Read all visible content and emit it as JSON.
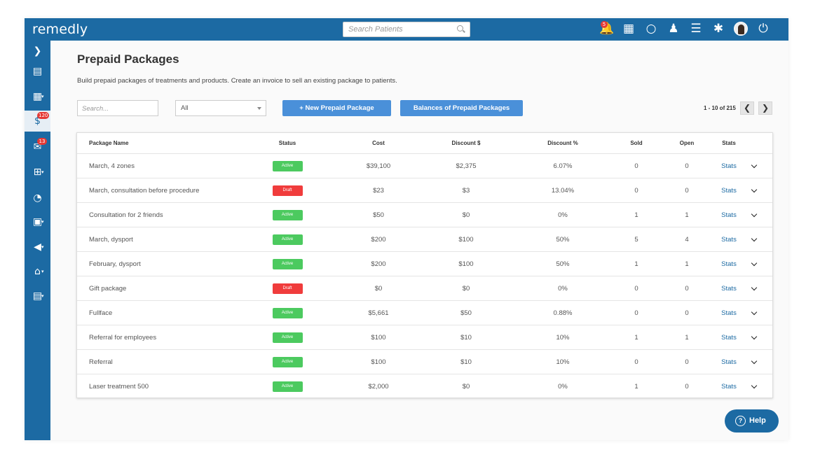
{
  "app": {
    "logo": "remedly"
  },
  "header": {
    "search_placeholder": "Search Patients",
    "icons": [
      {
        "name": "notifications-bell-icon",
        "glyph": "🔔",
        "badge": "5"
      },
      {
        "name": "calendar-icon",
        "glyph": "▦",
        "badge": ""
      },
      {
        "name": "chat-bubble-icon",
        "glyph": "○",
        "badge": ""
      },
      {
        "name": "add-patient-icon",
        "glyph": "♟",
        "badge": ""
      },
      {
        "name": "list-icon",
        "glyph": "☰",
        "badge": ""
      },
      {
        "name": "settings-gear-icon",
        "glyph": "✱",
        "badge": ""
      }
    ]
  },
  "sidebar": {
    "items": [
      {
        "name": "expand-chevron-icon",
        "glyph": "❯",
        "badge": "",
        "caret": false
      },
      {
        "name": "clipboard-icon",
        "glyph": "▤",
        "badge": "",
        "caret": false
      },
      {
        "name": "calendar-menu-icon",
        "glyph": "▦",
        "badge": "",
        "caret": true
      },
      {
        "name": "billing-dollar-icon",
        "glyph": "$",
        "badge": "120",
        "caret": false,
        "active": true
      },
      {
        "name": "messages-icon",
        "glyph": "✉",
        "badge": "13",
        "caret": false
      },
      {
        "name": "medical-kit-icon",
        "glyph": "⊞",
        "badge": "",
        "caret": true
      },
      {
        "name": "reports-pie-icon",
        "glyph": "◔",
        "badge": "",
        "caret": false
      },
      {
        "name": "calculator-icon",
        "glyph": "▣",
        "badge": "",
        "caret": true
      },
      {
        "name": "marketing-megaphone-icon",
        "glyph": "◀",
        "badge": "",
        "caret": true
      },
      {
        "name": "clinic-settings-icon",
        "glyph": "⌂",
        "badge": "",
        "caret": true
      },
      {
        "name": "forms-clipboard-icon",
        "glyph": "▤",
        "badge": "",
        "caret": true
      }
    ]
  },
  "page": {
    "title": "Prepaid Packages",
    "description": "Build prepaid packages of treatments and products. Create an invoice to sell an existing package to patients.",
    "search_placeholder": "Search...",
    "filter_value": "All",
    "new_button": "+ New Prepaid Package",
    "balances_button": "Balances of Prepaid Packages",
    "pagination": "1 - 10 of 215",
    "prev_glyph": "❮",
    "next_glyph": "❯"
  },
  "table": {
    "headers": {
      "name": "Package Name",
      "status": "Status",
      "cost": "Cost",
      "discount": "Discount $",
      "discount_pct": "Discount %",
      "sold": "Sold",
      "open": "Open",
      "stats": "Stats"
    },
    "rows": [
      {
        "name": "March, 4 zones",
        "status": "Active",
        "cost": "$39,100",
        "discount": "$2,375",
        "discount_pct": "6.07%",
        "sold": "0",
        "open": "0",
        "stats": "Stats"
      },
      {
        "name": "March, consultation before procedure",
        "status": "Draft",
        "cost": "$23",
        "discount": "$3",
        "discount_pct": "13.04%",
        "sold": "0",
        "open": "0",
        "stats": "Stats"
      },
      {
        "name": "Consultation for 2 friends",
        "status": "Active",
        "cost": "$50",
        "discount": "$0",
        "discount_pct": "0%",
        "sold": "1",
        "open": "1",
        "stats": "Stats"
      },
      {
        "name": "March, dysport",
        "status": "Active",
        "cost": "$200",
        "discount": "$100",
        "discount_pct": "50%",
        "sold": "5",
        "open": "4",
        "stats": "Stats"
      },
      {
        "name": "February, dysport",
        "status": "Active",
        "cost": "$200",
        "discount": "$100",
        "discount_pct": "50%",
        "sold": "1",
        "open": "1",
        "stats": "Stats"
      },
      {
        "name": "Gift package",
        "status": "Draft",
        "cost": "$0",
        "discount": "$0",
        "discount_pct": "0%",
        "sold": "0",
        "open": "0",
        "stats": "Stats"
      },
      {
        "name": "Fullface",
        "status": "Active",
        "cost": "$5,661",
        "discount": "$50",
        "discount_pct": "0.88%",
        "sold": "0",
        "open": "0",
        "stats": "Stats"
      },
      {
        "name": "Referral for employees",
        "status": "Active",
        "cost": "$100",
        "discount": "$10",
        "discount_pct": "10%",
        "sold": "1",
        "open": "1",
        "stats": "Stats"
      },
      {
        "name": "Referral",
        "status": "Active",
        "cost": "$100",
        "discount": "$10",
        "discount_pct": "10%",
        "sold": "0",
        "open": "0",
        "stats": "Stats"
      },
      {
        "name": "Laser treatment 500",
        "status": "Active",
        "cost": "$2,000",
        "discount": "$0",
        "discount_pct": "0%",
        "sold": "1",
        "open": "0",
        "stats": "Stats"
      }
    ]
  },
  "status_colors": {
    "Active": "#4cca5f",
    "Draft": "#f03c3c"
  },
  "help": {
    "label": "Help",
    "glyph": "?"
  }
}
